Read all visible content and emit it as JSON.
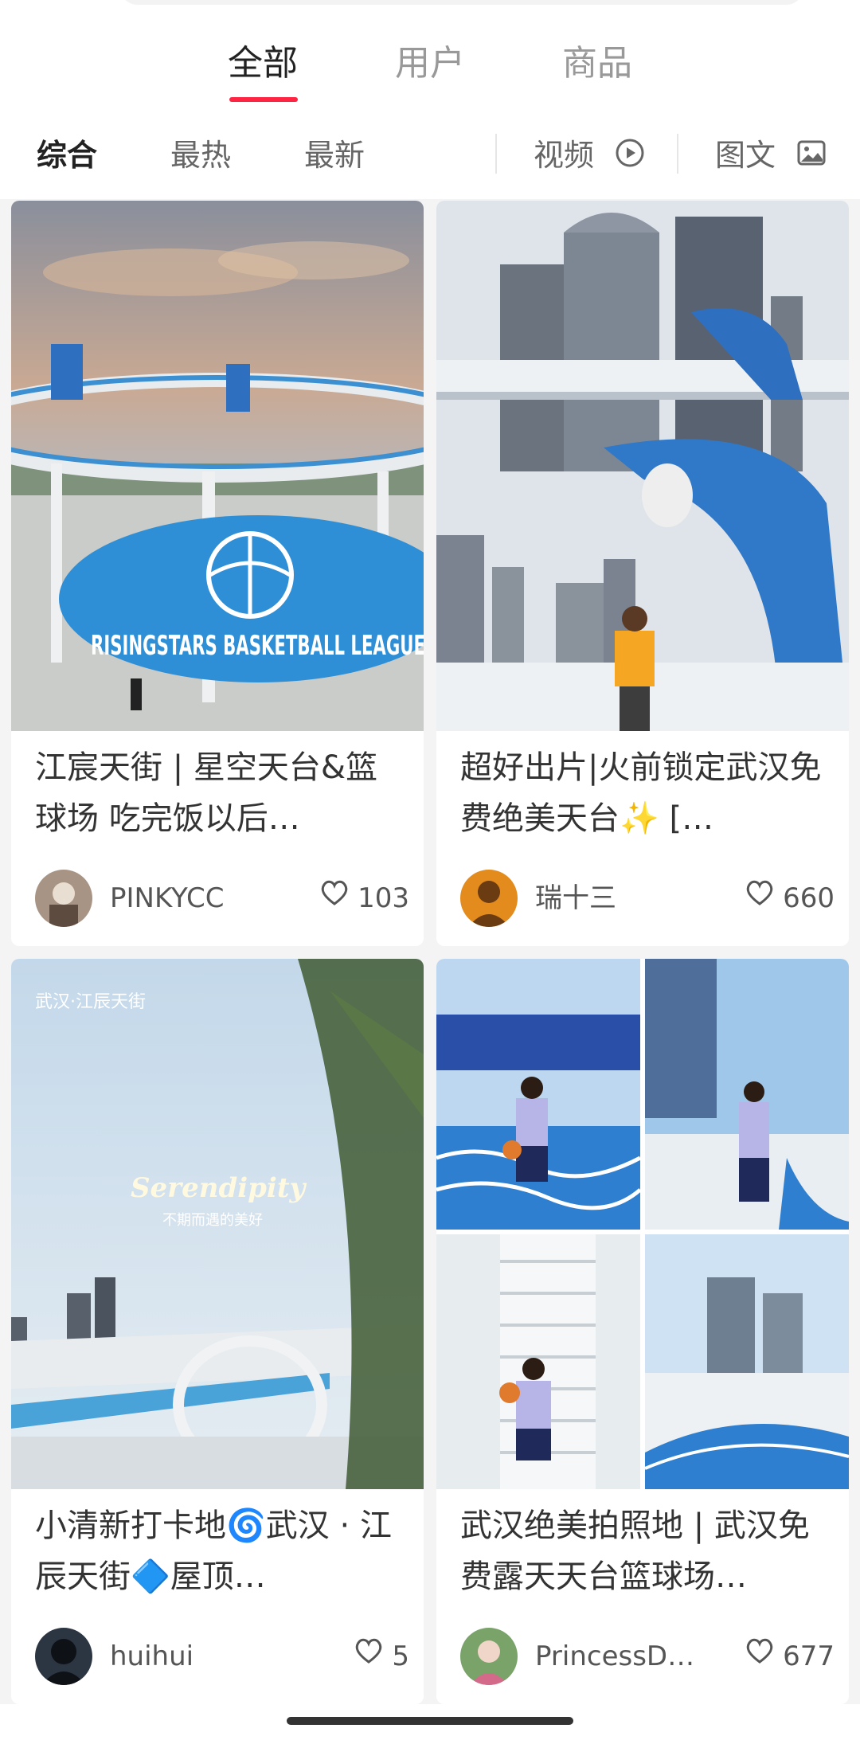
{
  "tabs": [
    {
      "label": "全部",
      "active": true
    },
    {
      "label": "用户",
      "active": false
    },
    {
      "label": "商品",
      "active": false
    }
  ],
  "filters": {
    "sort": [
      "综合",
      "最热",
      "最新"
    ],
    "video": {
      "label": "视频",
      "icon": "play-circle-icon"
    },
    "image_text": {
      "label": "图文",
      "icon": "image-icon"
    }
  },
  "cards": [
    {
      "title": "江宸天街 | 星空天台&篮球场 吃完饭以后…",
      "author": "PINKYCC",
      "likes": "103",
      "court_text": "RISINGSTARS BASKETBALL LEAGUE"
    },
    {
      "title": "超好出片|火前锁定武汉免费绝美天台✨ […",
      "author": "瑞十三",
      "likes": "660"
    },
    {
      "title": "小清新打卡地🌀武汉 · 江辰天街🔷屋顶…",
      "author": "huihui",
      "likes": "5",
      "overlay_location": "武汉·江辰天街",
      "overlay_word": "Serendipity",
      "overlay_sub": "不期而遇的美好"
    },
    {
      "title": "武汉绝美拍照地 | 武汉免费露天天台篮球场…",
      "author": "PrincessDX…",
      "likes": "677"
    }
  ],
  "colors": {
    "accent": "#ff2442",
    "court_blue": "#2f8fd6",
    "sky": "#cfe3f2"
  }
}
